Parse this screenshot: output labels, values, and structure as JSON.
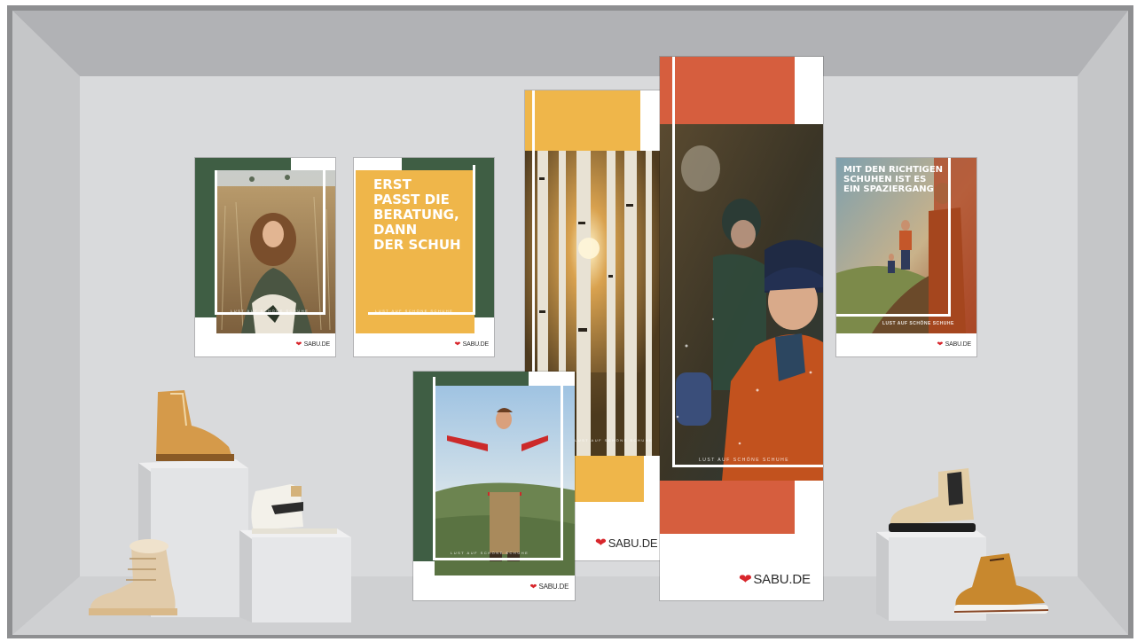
{
  "scene": {
    "wall_color": "#d9dadc",
    "ceiling_color": "#b1b2b5",
    "side_wall_color": "#c8c9cb",
    "floor_color": "#d4d5d7",
    "frame_color": "#8e8f91"
  },
  "colors": {
    "forest_green": "#3f5e44",
    "mustard": "#efb64a",
    "terracotta": "#d65e3e",
    "brand_red": "#d8262c"
  },
  "posters": [
    {
      "id": "girl-field",
      "brand": "SABU.DE",
      "tagline": "LUST AUF SCHÖNE SCHUHE"
    },
    {
      "id": "text-beratung",
      "brand": "SABU.DE",
      "headline": [
        "ERST",
        "PASST DIE",
        "BERATUNG,",
        "DANN",
        "DER SCHUH"
      ],
      "tagline": "LUST AUF SCHÖNE SCHUHE"
    },
    {
      "id": "birch-forest",
      "brand": "SABU.DE",
      "tagline": "LUST AUF SCHÖNE SCHUHE"
    },
    {
      "id": "boy-red-jacket",
      "brand": "SABU.DE",
      "tagline": "LUST AUF SCHÖNE SCHUHE"
    },
    {
      "id": "kids-snow",
      "brand": "SABU.DE",
      "tagline": "LUST AUF SCHÖNE SCHUHE"
    },
    {
      "id": "hikers",
      "brand": "SABU.DE",
      "headline": [
        "MIT DEN RICHTIGEN",
        "SCHUHEN IST ES",
        "EIN SPAZIERGANG"
      ],
      "tagline": "LUST AUF SCHÖNE SCHUHE"
    }
  ],
  "shoes": [
    {
      "id": "tan-lace-up-boot",
      "icon": "boot-icon"
    },
    {
      "id": "white-sneaker-stripe",
      "icon": "sneaker-icon"
    },
    {
      "id": "beige-fur-boot",
      "icon": "boot-icon"
    },
    {
      "id": "beige-chelsea-boot",
      "icon": "boot-icon"
    },
    {
      "id": "tan-hiking-sneaker",
      "icon": "sneaker-icon"
    }
  ]
}
